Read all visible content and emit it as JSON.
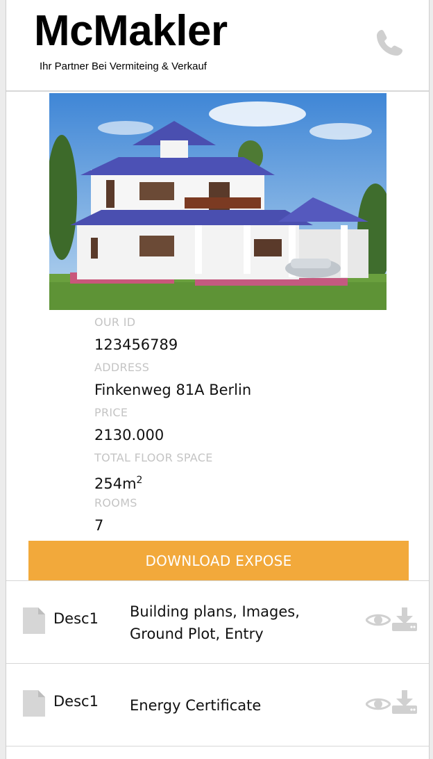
{
  "header": {
    "logo": "McMakler",
    "tagline": "Ihr Partner Bei Vermiteing & Verkauf",
    "phone_icon": "phone-icon"
  },
  "property": {
    "id_label": "OUR ID",
    "id_value": "123456789",
    "address_label": "ADDRESS",
    "address_value": "Finkenweg 81A Berlin",
    "price_label": "PRICE",
    "price_value": "2130.000",
    "floor_label": "TOTAL FLOOR SPACE",
    "floor_value": "254m",
    "floor_unit_sup": "2",
    "rooms_label": "ROOMS",
    "rooms_value": "7"
  },
  "download_button": "DOWNLOAD EXPOSE",
  "documents": [
    {
      "name": "Desc1",
      "description_line1": "Building plans, Images,",
      "description_line2": "Ground Plot, Entry"
    },
    {
      "name": "Desc1",
      "description_line1": "Energy Certificate",
      "description_line2": ""
    }
  ],
  "colors": {
    "accent": "#f2a93b",
    "label_gray": "#c4c4c4",
    "icon_gray": "#d0d0d0"
  }
}
